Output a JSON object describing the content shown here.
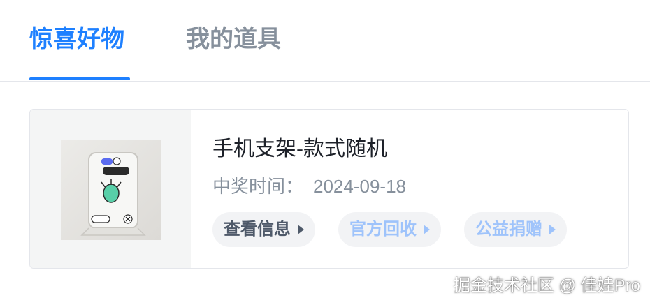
{
  "tabs": [
    {
      "label": "惊喜好物",
      "active": true
    },
    {
      "label": "我的道具",
      "active": false
    }
  ],
  "prize": {
    "name": "手机支架-款式随机",
    "time_label": "中奖时间：",
    "time_value": "2024-09-18",
    "image_icon": "phone-stand-image"
  },
  "actions": [
    {
      "label": "查看信息",
      "enabled": true
    },
    {
      "label": "官方回收",
      "enabled": false
    },
    {
      "label": "公益捐赠",
      "enabled": false
    }
  ],
  "watermark": "掘金技术社区 @ 佳娃Pro",
  "colors": {
    "accent": "#1e80ff",
    "muted_text": "#86909c",
    "disabled_action": "#9ec3fb",
    "action_bg": "#f2f3f5"
  }
}
